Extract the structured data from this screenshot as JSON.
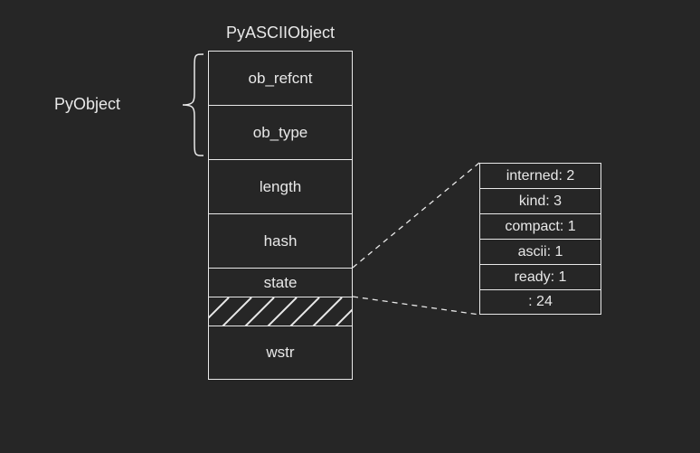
{
  "title": "PyASCIIObject",
  "pyobject_label": "PyObject",
  "struct": {
    "ob_refcnt": "ob_refcnt",
    "ob_type": "ob_type",
    "length": "length",
    "hash": "hash",
    "state": "state",
    "padding": "",
    "wstr": "wstr"
  },
  "state_detail": {
    "interned": "interned: 2",
    "kind": "kind: 3",
    "compact": "compact: 1",
    "ascii": "ascii: 1",
    "ready": "ready: 1",
    "pad": ": 24"
  }
}
